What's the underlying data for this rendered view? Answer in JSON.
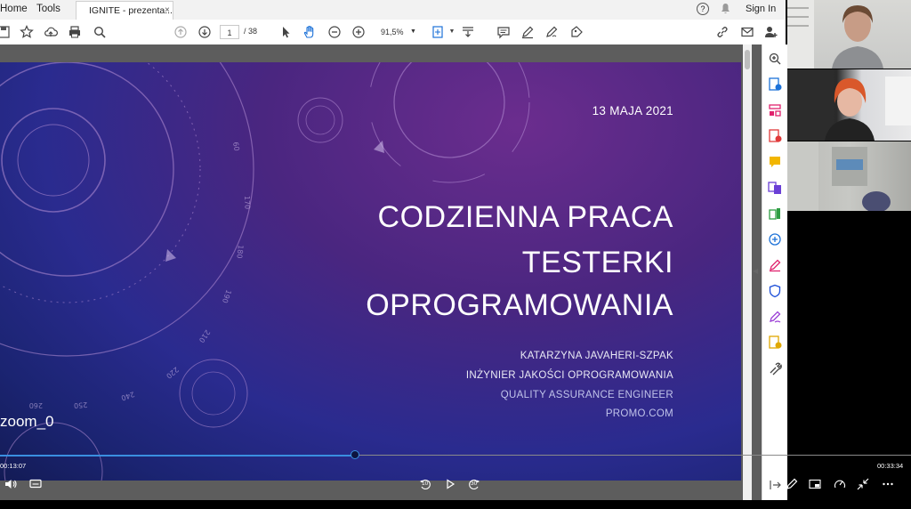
{
  "tabbar": {
    "home_label": "Home",
    "tools_label": "Tools",
    "document_tab_label": "IGNITE - prezenta...",
    "close_glyph": "×",
    "signin_label": "Sign In"
  },
  "toolbar": {
    "current_page": "1",
    "total_pages": "/ 38",
    "zoom_level": "91,5%"
  },
  "slide": {
    "date": "13 MAJA 2021",
    "title_lines": [
      "CODZIENNA PRACA",
      "TESTERKI",
      "OPROGRAMOWANIA"
    ],
    "author": "KATARZYNA JAVAHERI-SZPAK",
    "role_pl": "INŻYNIER JAKOŚCI OPROGRAMOWANIA",
    "role_en": "QUALITY ASSURANCE ENGINEER",
    "company": "PROMO.COM"
  },
  "player": {
    "source_label": "zoom_0",
    "elapsed": "00:13:07",
    "duration": "00:33:34",
    "progress_fraction": 0.39,
    "skip_back_label": "10",
    "skip_forward_label": "30"
  },
  "colors": {
    "progress_accent": "#3a8fe0",
    "slide_purple": "#4a2680",
    "slide_blue": "#1b2472"
  }
}
